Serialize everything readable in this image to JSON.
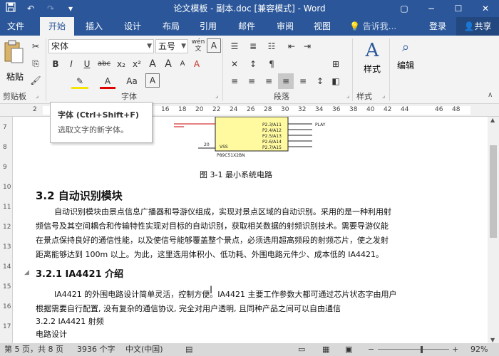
{
  "window": {
    "title": "论文模板 - 副本.doc [兼容模式] - Word",
    "brand_color": "#2b579a"
  },
  "quick_access": {
    "save_icon": "save-icon",
    "undo_icon": "undo-icon",
    "redo_icon": "redo-icon"
  },
  "tabs": [
    {
      "label": "文件"
    },
    {
      "label": "开始"
    },
    {
      "label": "插入"
    },
    {
      "label": "设计"
    },
    {
      "label": "布局"
    },
    {
      "label": "引用"
    },
    {
      "label": "邮件"
    },
    {
      "label": "审阅"
    },
    {
      "label": "视图"
    }
  ],
  "tell_me": {
    "placeholder": "告诉我..."
  },
  "account": {
    "login": "登录",
    "share": "共享"
  },
  "ribbon": {
    "clipboard": {
      "paste": "粘贴",
      "label": "剪贴板"
    },
    "font": {
      "name": "宋体",
      "size": "五号",
      "wen": "wén",
      "bold": "B",
      "italic": "I",
      "underline": "U",
      "strike": "abc",
      "sub": "x₂",
      "sup": "x²",
      "case": "Aa",
      "grow": "A",
      "shrink": "A",
      "clear": "A",
      "label": "字体"
    },
    "paragraph": {
      "label": "段落"
    },
    "styles": {
      "btn": "样式",
      "label": "样式"
    },
    "editing": {
      "btn": "编辑"
    }
  },
  "ruler": {
    "ticks": [
      "2",
      "14",
      "16",
      "18",
      "20",
      "22",
      "24",
      "26",
      "28",
      "30",
      "32",
      "34",
      "36",
      "38",
      "40",
      "42",
      "44",
      "46",
      "48"
    ],
    "vticks": [
      "7",
      "8",
      "9",
      "10",
      "11",
      "12",
      "13",
      "14",
      "15",
      "16",
      "17"
    ]
  },
  "tooltip": {
    "title": "字体 (Ctrl+Shift+F)",
    "desc": "选取文字的新字体。"
  },
  "document": {
    "circuit_labels": {
      "pins": [
        "P2.3/A11",
        "P2.4/A12",
        "P2.5/A13",
        "P2.6/A14",
        "P2.7/A15"
      ],
      "play": "PLAY",
      "vss": "VSS",
      "chip": "P89C51X2BN",
      "pin_num": "20"
    },
    "caption": "图 3-1  最小系统电路",
    "heading_3_2": "3.2  自动识别模块",
    "para1": [
      "自动识别模块由景点信息广播器和导游仪组成，实现对景点区域的自动识别。采用的是一种利用射",
      "频信号及其空间耦合和传输特性实现对目标的自动识别，获取相关数据的射频识别技术。需要导游仪能",
      "在景点保持良好的通信性能，以及使信号能够覆盖整个景点，必须选用超高频段的射频芯片，使之发射",
      "距离能够达到 100m 以上。为此，这里选用体积小、低功耗、外围电路元件少、成本低的 IA4421。"
    ],
    "heading_3_2_1": "3.2.1 IA4421 介绍",
    "para2": [
      "IA4421 的外围电路设计简单灵活，控制方便。IA4421 主要工作参数大都可通过芯片状态字由用户",
      "根据需要自行配置, 没有复杂的通信协议, 完全对用户透明, 且同种产品之间可以自由通信",
      "3.2.2  IA4421 射频",
      "电路设计"
    ]
  },
  "status": {
    "page": "第 5 页，共 8 页",
    "words": "3936 个字",
    "lang": "中文(中国)",
    "zoom": "92%"
  }
}
